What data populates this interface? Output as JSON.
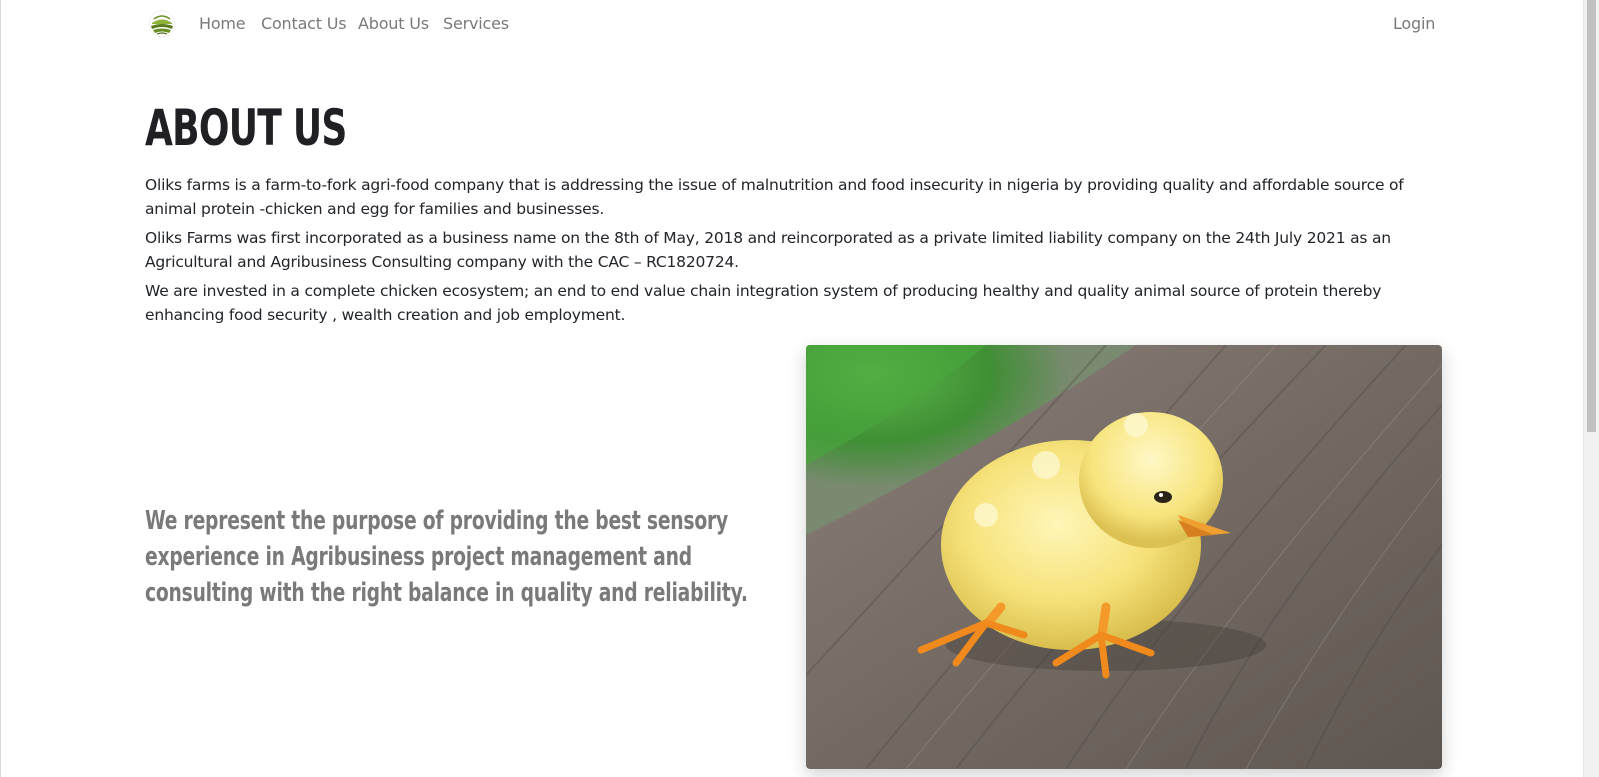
{
  "nav": {
    "logo_icon": "farm-field-logo-icon",
    "links": [
      "Home",
      "Contact Us",
      "About Us",
      "Services"
    ],
    "login": "Login"
  },
  "about": {
    "title": "ABOUT US",
    "paragraphs": [
      "Oliks farms is a farm-to-fork agri-food company that is addressing the issue of malnutrition and food insecurity in nigeria by providing quality and affordable source of animal protein -chicken and egg for families and businesses.",
      "Oliks Farms was first incorporated as a business name on the 8th of May, 2018 and reincorporated as a private limited liability company on the 24th July 2021 as an Agricultural and Agribusiness Consulting company with the CAC – RC1820724.",
      "We are invested in a complete chicken ecosystem; an end to end value chain integration system of producing healthy and quality animal source of protein thereby enhancing food security , wealth creation and job employment."
    ],
    "tagline": "We represent the purpose of providing the best sensory experience in Agribusiness project management and consulting with the right balance in quality and reliability.",
    "image_icon": "baby-chick-photo"
  },
  "colors": {
    "heading": "#1f1f24",
    "nav_text": "#7a7a7a",
    "tagline": "#7a7a7a",
    "logo_green": "#6b8e23"
  }
}
